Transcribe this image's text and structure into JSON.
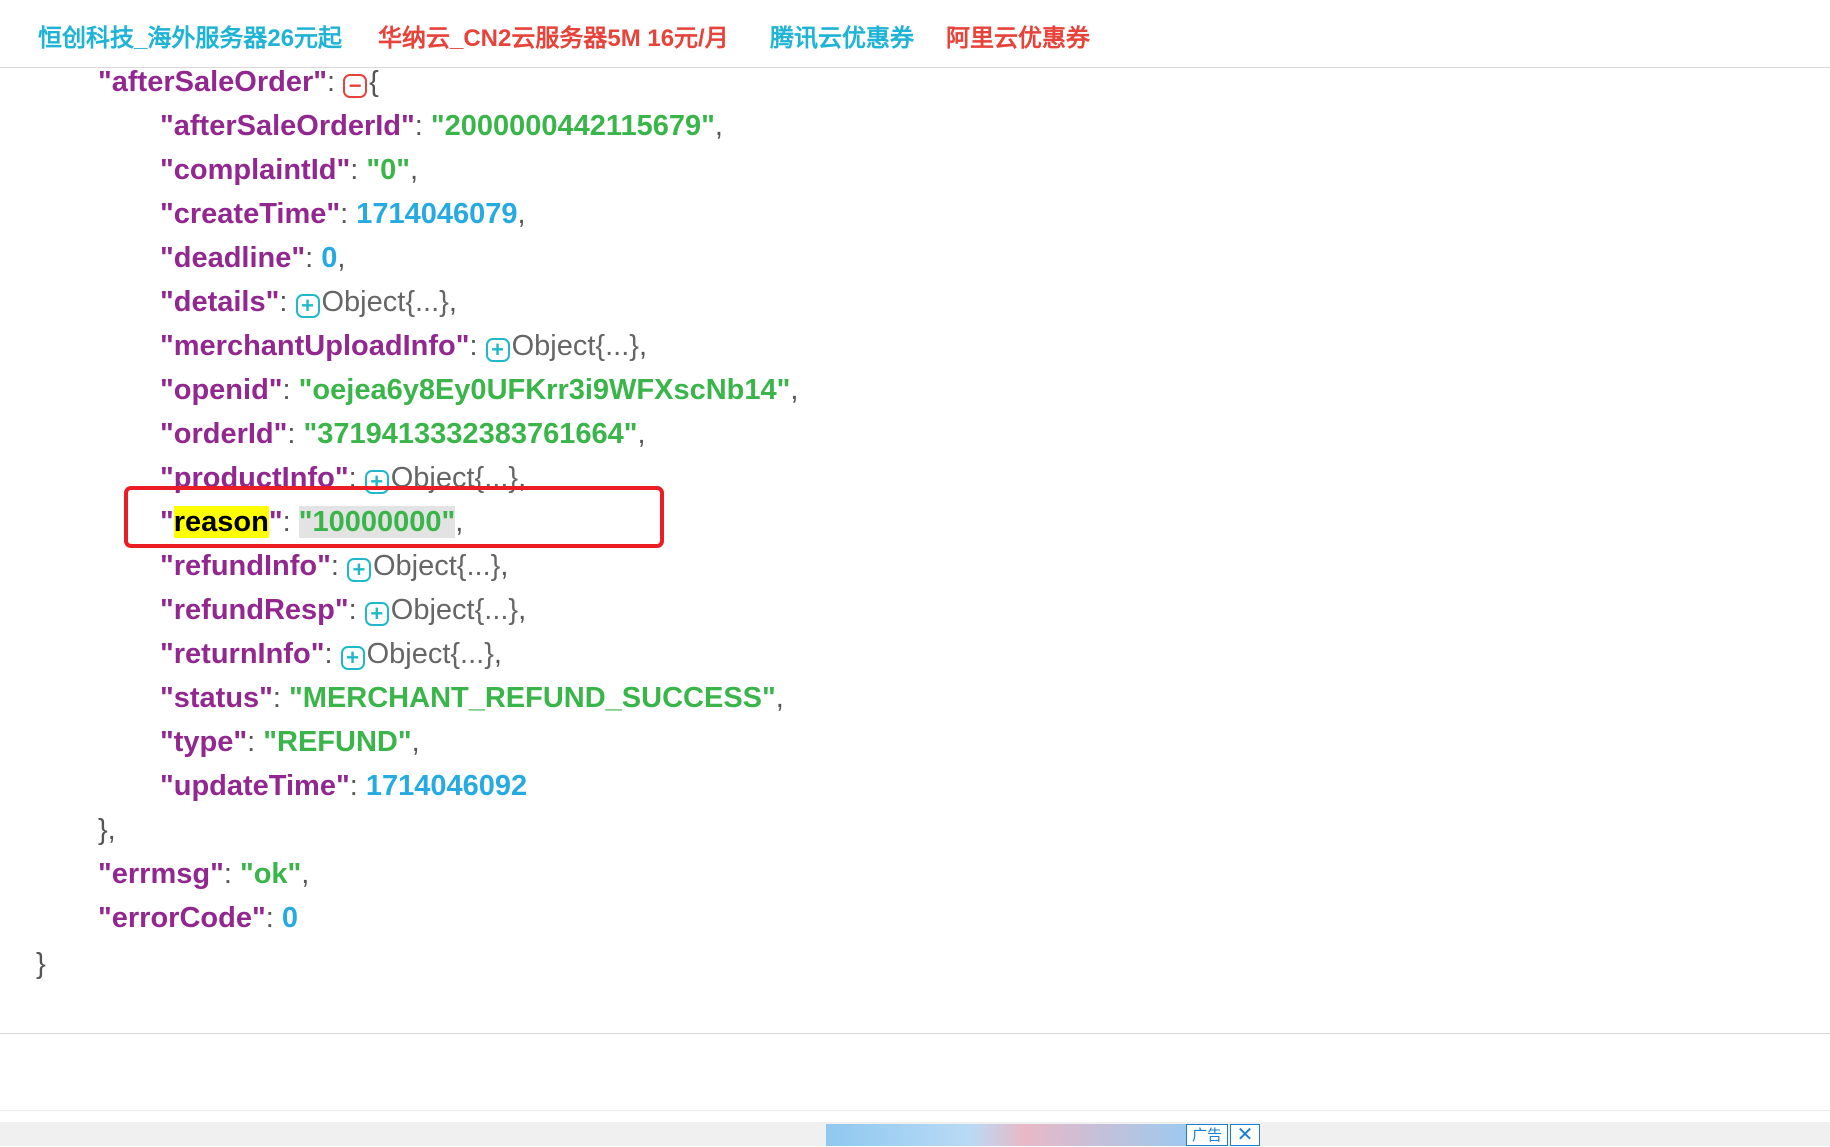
{
  "top_links": [
    {
      "label": "恒创科技_海外服务器26元起",
      "color": "#1fb3d6"
    },
    {
      "label": "华纳云_CN2云服务器5M 16元/月",
      "color": "#e8433a"
    },
    {
      "label": "腾讯云优惠券",
      "color": "#1fb3d6"
    },
    {
      "label": "阿里云优惠券",
      "color": "#e8433a"
    }
  ],
  "json_view": {
    "after_sale_key": "afterSaleOrder",
    "fields": {
      "afterSaleOrderId": {
        "key": "afterSaleOrderId",
        "value": "2000000442115679"
      },
      "complaintId": {
        "key": "complaintId",
        "value": "0"
      },
      "createTime": {
        "key": "createTime",
        "value": "1714046079"
      },
      "deadline": {
        "key": "deadline",
        "value": "0"
      },
      "details": {
        "key": "details",
        "value": "Object{...}"
      },
      "merchantUploadInfo": {
        "key": "merchantUploadInfo",
        "value": "Object{...}"
      },
      "openid": {
        "key": "openid",
        "value": "oejea6y8Ey0UFKrr3i9WFXscNb14"
      },
      "orderId": {
        "key": "orderId",
        "value": "3719413332383761664"
      },
      "productInfo": {
        "key": "productInfo",
        "value": "Object{...}"
      },
      "reason": {
        "key": "reason",
        "value": "10000000"
      },
      "refundInfo": {
        "key": "refundInfo",
        "value": "Object{...}"
      },
      "refundResp": {
        "key": "refundResp",
        "value": "Object{...}"
      },
      "returnInfo": {
        "key": "returnInfo",
        "value": "Object{...}"
      },
      "status": {
        "key": "status",
        "value": "MERCHANT_REFUND_SUCCESS"
      },
      "type": {
        "key": "type",
        "value": "REFUND"
      },
      "updateTime": {
        "key": "updateTime",
        "value": "1714046092"
      }
    },
    "errmsg": {
      "key": "errmsg",
      "value": "ok"
    },
    "errorCode": {
      "key": "errorCode",
      "value": "0"
    }
  },
  "bottom_ad": {
    "label": "广告",
    "close": "✕"
  },
  "colors": {
    "key": "#92278f",
    "string": "#3ab54a",
    "number": "#25aae1",
    "highlight_box": "#ec1c24"
  }
}
